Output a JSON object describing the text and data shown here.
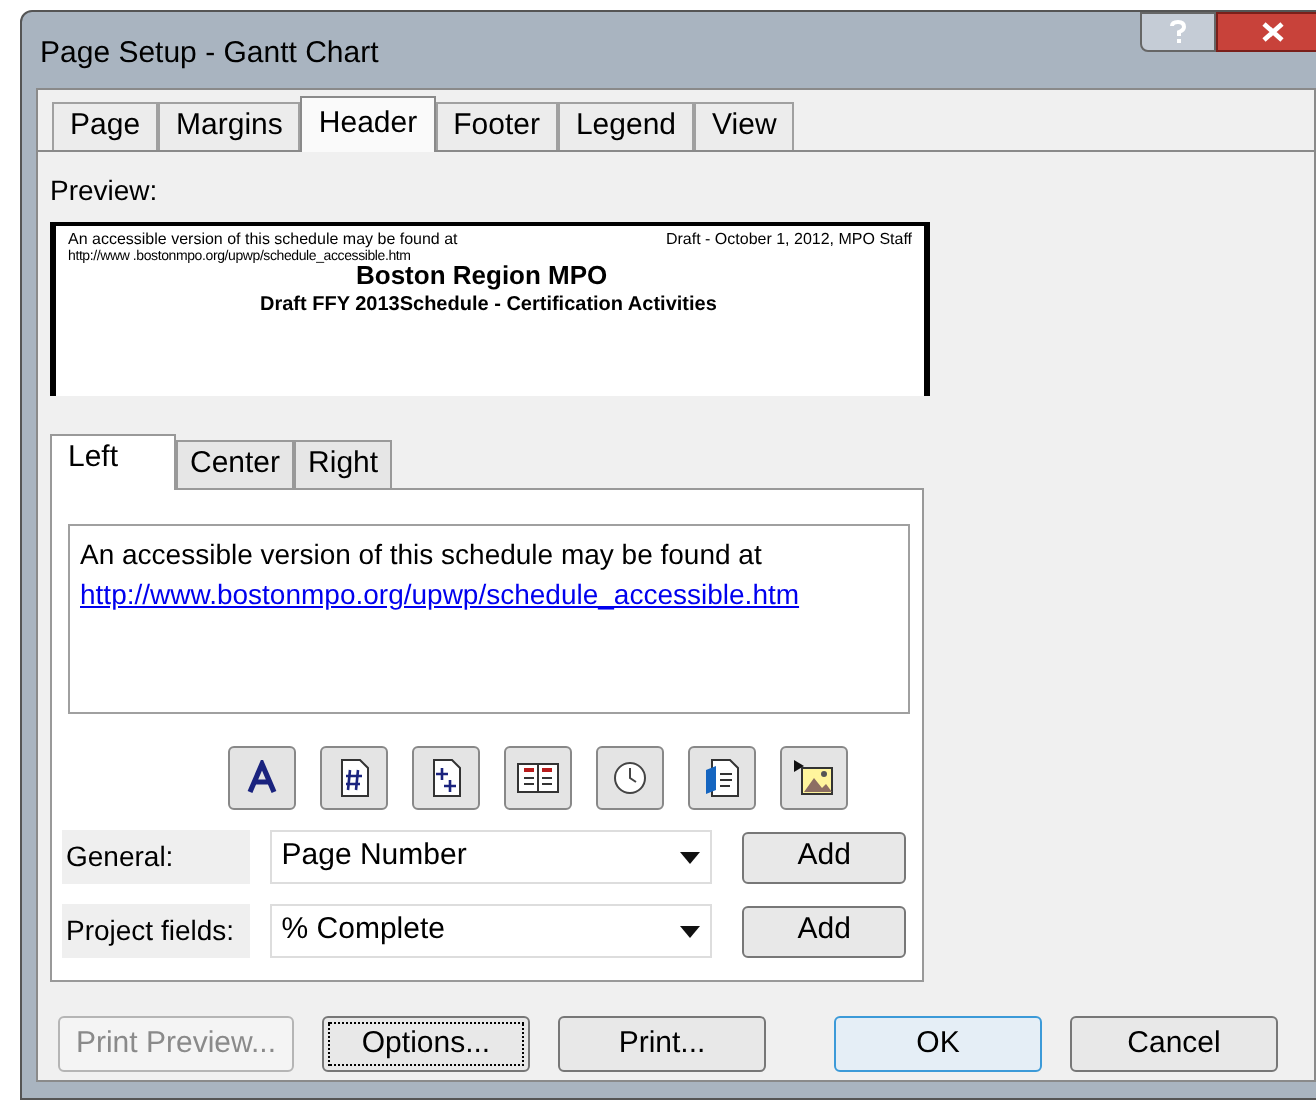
{
  "window": {
    "title": "Page Setup - Gantt Chart"
  },
  "tabs": [
    {
      "label": "Page",
      "selected": false
    },
    {
      "label": "Margins",
      "selected": false
    },
    {
      "label": "Header",
      "selected": true
    },
    {
      "label": "Footer",
      "selected": false
    },
    {
      "label": "Legend",
      "selected": false
    },
    {
      "label": "View",
      "selected": false
    }
  ],
  "preview": {
    "label": "Preview:",
    "left_lines": [
      "An accessible version of this schedule may be found at",
      "http://www .bostonmpo.org/upwp/schedule_accessible.htm"
    ],
    "right": "Draft - October 1, 2012, MPO Staff",
    "center_title": "Boston Region MPO",
    "center_subtitle": "Draft FFY 2013Schedule - Certification Activities"
  },
  "section_tabs": [
    {
      "label": "Left",
      "selected": true
    },
    {
      "label": "Center",
      "selected": false
    },
    {
      "label": "Right",
      "selected": false
    }
  ],
  "editor": {
    "text": "An accessible version of this schedule may be found at",
    "link": "http://www.bostonmpo.org/upwp/schedule_accessible.htm"
  },
  "format_buttons": [
    {
      "kind": "font"
    },
    {
      "kind": "page-number"
    },
    {
      "kind": "page-count"
    },
    {
      "kind": "date"
    },
    {
      "kind": "time"
    },
    {
      "kind": "file-name"
    },
    {
      "kind": "picture"
    }
  ],
  "fields": [
    {
      "label": "General:",
      "value": "Page Number",
      "button": "Add"
    },
    {
      "label": "Project fields:",
      "value": "% Complete",
      "button": "Add"
    }
  ],
  "buttons": [
    {
      "label": "Print Preview...",
      "disabled": true,
      "focused": false,
      "default": false
    },
    {
      "label": "Options...",
      "disabled": false,
      "focused": true,
      "default": false
    },
    {
      "label": "Print...",
      "disabled": false,
      "focused": false,
      "default": false
    },
    {
      "label": "OK",
      "disabled": false,
      "focused": false,
      "default": true
    },
    {
      "label": "Cancel",
      "disabled": false,
      "focused": false,
      "default": false
    }
  ]
}
